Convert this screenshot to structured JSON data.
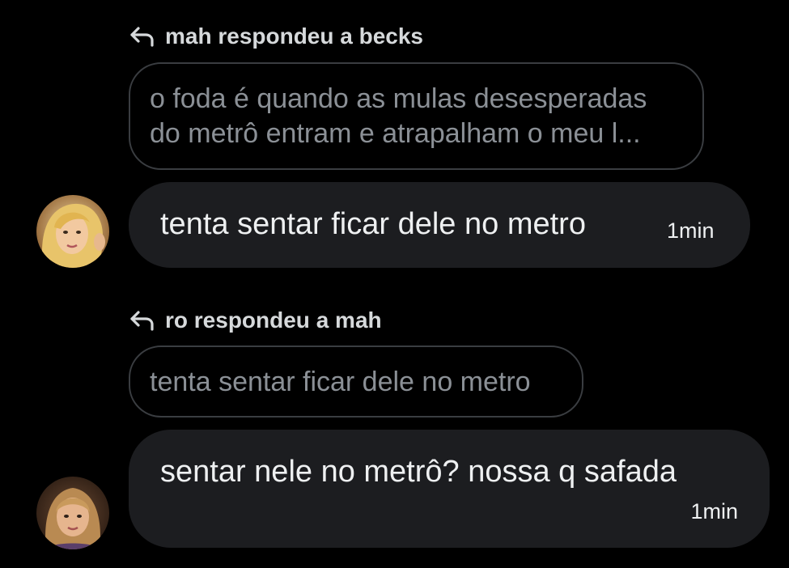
{
  "thread": [
    {
      "reply_header": "mah respondeu a becks",
      "quote_line1": "o foda é quando as mulas desesperadas",
      "quote_line2": "do metrô entram e atrapalham o meu l...",
      "message": "tenta sentar ficar dele no metro",
      "time": "1min",
      "avatar_icon": "blonde-woman-avatar"
    },
    {
      "reply_header": "ro respondeu a mah",
      "quote_line1": "tenta sentar ficar dele no metro",
      "message": "sentar nele no metrô? nossa q safada",
      "time": "1min",
      "avatar_icon": "brunette-woman-avatar"
    }
  ],
  "colors": {
    "background": "#000000",
    "bubble": "#1c1d20",
    "quote_border": "#3a3d41",
    "quote_text": "#8b9096",
    "message_text": "#eef0f1"
  }
}
